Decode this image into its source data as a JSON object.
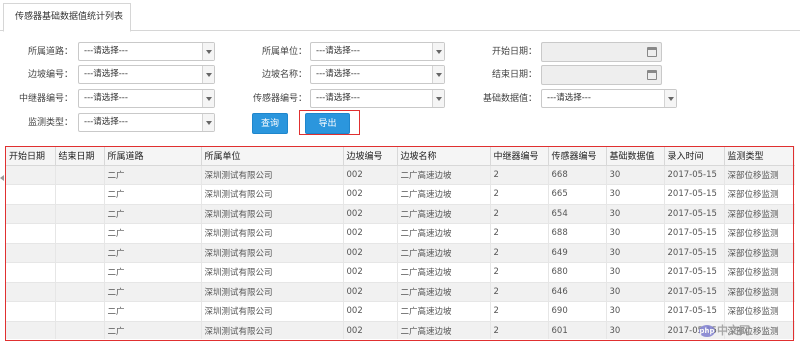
{
  "tab": {
    "label": "传感器基础数据值统计列表"
  },
  "filters": {
    "road": {
      "label": "所属道路：",
      "value": "---请选择---"
    },
    "unit": {
      "label": "所属单位：",
      "value": "---请选择---"
    },
    "start_date": {
      "label": "开始日期：",
      "value": ""
    },
    "slope_no": {
      "label": "边坡编号：",
      "value": "---请选择---"
    },
    "slope_name": {
      "label": "边坡名称：",
      "value": "---请选择---"
    },
    "end_date": {
      "label": "结束日期：",
      "value": ""
    },
    "relay_no": {
      "label": "中继器编号：",
      "value": "---请选择---"
    },
    "sensor_no": {
      "label": "传感器编号：",
      "value": "---请选择---"
    },
    "base_value": {
      "label": "基础数据值：",
      "value": "---请选择---"
    },
    "monitor_type": {
      "label": "监测类型：",
      "value": "---请选择---"
    }
  },
  "buttons": {
    "query": "查询",
    "export": "导出"
  },
  "table": {
    "columns": [
      "开始日期",
      "结束日期",
      "所属道路",
      "所属单位",
      "边坡编号",
      "边坡名称",
      "中继器编号",
      "传感器编号",
      "基础数据值",
      "录入时间",
      "监测类型"
    ],
    "rows": [
      [
        "",
        "",
        "二广",
        "深圳测试有限公司",
        "002",
        "二广高速边坡",
        "2",
        "668",
        "30",
        "2017-05-15",
        "深部位移监测"
      ],
      [
        "",
        "",
        "二广",
        "深圳测试有限公司",
        "002",
        "二广高速边坡",
        "2",
        "665",
        "30",
        "2017-05-15",
        "深部位移监测"
      ],
      [
        "",
        "",
        "二广",
        "深圳测试有限公司",
        "002",
        "二广高速边坡",
        "2",
        "654",
        "30",
        "2017-05-15",
        "深部位移监测"
      ],
      [
        "",
        "",
        "二广",
        "深圳测试有限公司",
        "002",
        "二广高速边坡",
        "2",
        "688",
        "30",
        "2017-05-15",
        "深部位移监测"
      ],
      [
        "",
        "",
        "二广",
        "深圳测试有限公司",
        "002",
        "二广高速边坡",
        "2",
        "649",
        "30",
        "2017-05-15",
        "深部位移监测"
      ],
      [
        "",
        "",
        "二广",
        "深圳测试有限公司",
        "002",
        "二广高速边坡",
        "2",
        "680",
        "30",
        "2017-05-15",
        "深部位移监测"
      ],
      [
        "",
        "",
        "二广",
        "深圳测试有限公司",
        "002",
        "二广高速边坡",
        "2",
        "646",
        "30",
        "2017-05-15",
        "深部位移监测"
      ],
      [
        "",
        "",
        "二广",
        "深圳测试有限公司",
        "002",
        "二广高速边坡",
        "2",
        "690",
        "30",
        "2017-05-15",
        "深部位移监测"
      ],
      [
        "",
        "",
        "二广",
        "深圳测试有限公司",
        "002",
        "二广高速边坡",
        "2",
        "601",
        "30",
        "2017-05-15",
        "深部位移监测"
      ]
    ]
  },
  "watermark": {
    "text": "中文网",
    "logo_text": "php"
  },
  "colors": {
    "accent": "#2b96dd",
    "highlight": "#e03030"
  }
}
